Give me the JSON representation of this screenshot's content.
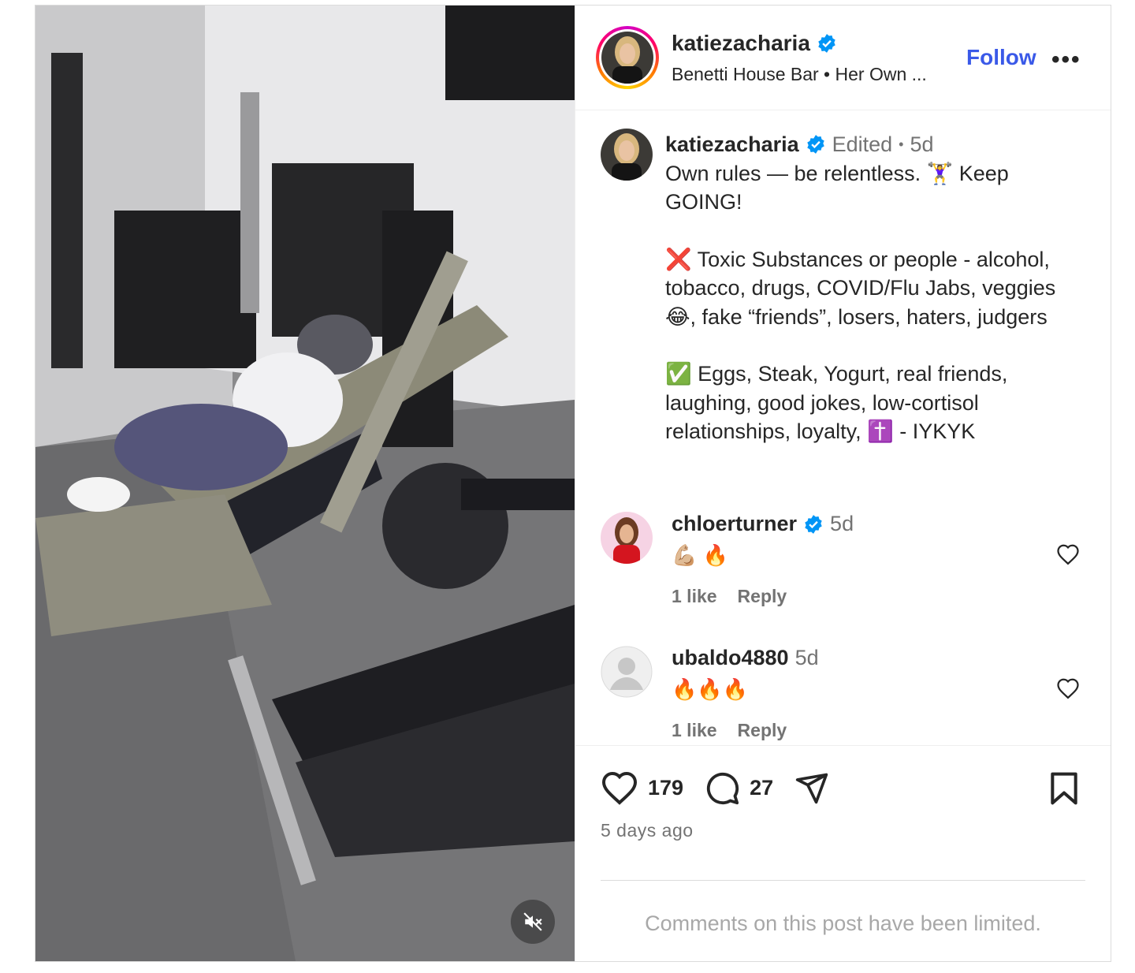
{
  "post": {
    "username": "katiezacharia",
    "location": "Benetti House Bar • Her Own ...",
    "follow_label": "Follow",
    "more_label": "•••"
  },
  "caption": {
    "username": "katiezacharia",
    "edited": "Edited",
    "dot": "•",
    "age": "5d",
    "line1": "Own rules — be relentless. 🏋️‍♀️ Keep GOING!",
    "line2": "❌ Toxic Substances or people - alcohol, tobacco, drugs, COVID/Flu Jabs, veggies 😂, fake “friends”, losers, haters, judgers",
    "line3": "✅ Eggs, Steak, Yogurt, real friends, laughing, good jokes, low-cortisol relationships, loyalty, ✝️ - IYKYK"
  },
  "comments": [
    {
      "username": "chloerturner",
      "verified": true,
      "age": "5d",
      "text": "💪🏼 🔥",
      "likes": "1 like",
      "reply_label": "Reply"
    },
    {
      "username": "ubaldo4880",
      "verified": false,
      "age": "5d",
      "text": "🔥🔥🔥",
      "likes": "1 like",
      "reply_label": "Reply"
    }
  ],
  "footer": {
    "like_count": "179",
    "comment_count": "27",
    "posted_ago": "5 days ago",
    "limited_notice": "Comments on this post have been limited."
  },
  "colors": {
    "accent": "#3a59e8",
    "verified": "#0095f6",
    "muted": "#737373"
  },
  "icons": [
    "heart-icon",
    "comment-icon",
    "share-icon",
    "bookmark-icon",
    "verified-icon",
    "mute-icon",
    "more-icon"
  ]
}
